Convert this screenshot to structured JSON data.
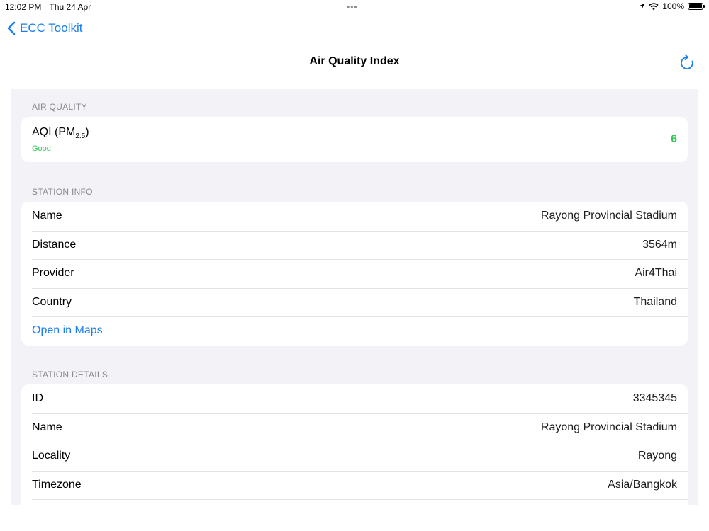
{
  "status_bar": {
    "time": "12:02 PM",
    "date": "Thu 24 Apr",
    "battery": "100%"
  },
  "nav": {
    "back_label": "ECC Toolkit",
    "title": "Air Quality Index"
  },
  "air_quality": {
    "header": "AIR QUALITY",
    "label_main": "AQI (PM",
    "label_sub": "2.5",
    "label_end": ")",
    "status": "Good",
    "value": "6",
    "accent_color": "#34c759"
  },
  "station_info": {
    "header": "STATION INFO",
    "rows": [
      {
        "label": "Name",
        "value": "Rayong Provincial Stadium"
      },
      {
        "label": "Distance",
        "value": "3564m"
      },
      {
        "label": "Provider",
        "value": "Air4Thai"
      },
      {
        "label": "Country",
        "value": "Thailand"
      }
    ],
    "link": "Open in Maps"
  },
  "station_details": {
    "header": "STATION DETAILS",
    "rows": [
      {
        "label": "ID",
        "value": "3345345"
      },
      {
        "label": "Name",
        "value": "Rayong Provincial Stadium"
      },
      {
        "label": "Locality",
        "value": "Rayong"
      },
      {
        "label": "Timezone",
        "value": "Asia/Bangkok"
      }
    ]
  },
  "colors": {
    "accent": "#1a7ff0",
    "background": "#f2f2f7"
  }
}
